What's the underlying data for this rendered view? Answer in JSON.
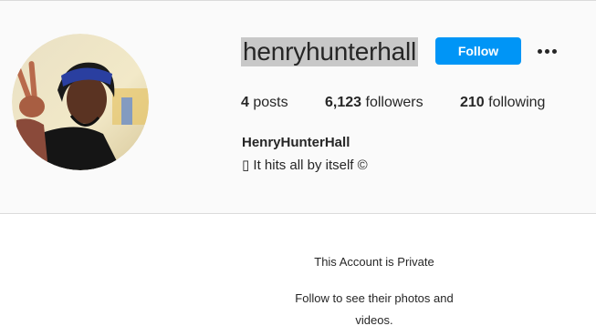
{
  "profile": {
    "username": "henryhunterhall",
    "follow_label": "Follow",
    "more_icon": "more-options-icon",
    "stats": {
      "posts_count": "4",
      "posts_label": "posts",
      "followers_count": "6,123",
      "followers_label": "followers",
      "following_count": "210",
      "following_label": "following"
    },
    "full_name": "HenryHunterHall",
    "bio": "▯ It hits all by itself ©",
    "avatar_icon": "profile-avatar"
  },
  "private_notice": {
    "title": "This Account is Private",
    "message": "Follow to see their photos and videos."
  },
  "colors": {
    "accent": "#0095f6",
    "header_bg": "#fafafa",
    "text": "#262626",
    "username_highlight": "#c8c8c8"
  }
}
